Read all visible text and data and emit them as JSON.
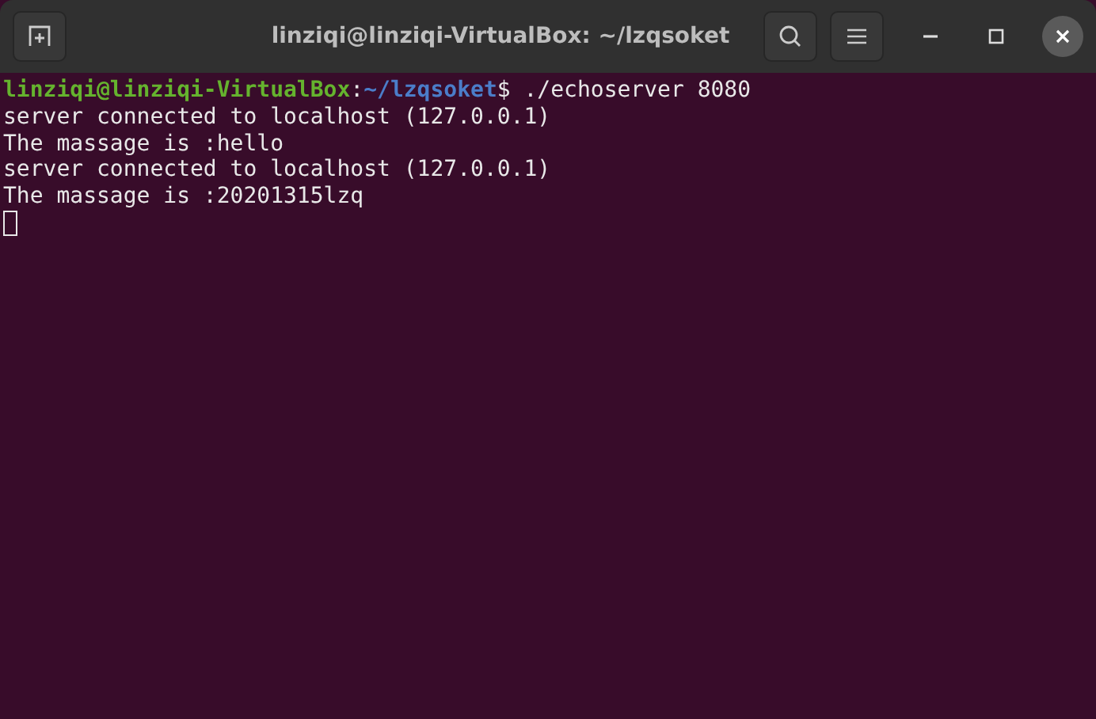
{
  "window": {
    "title": "linziqi@linziqi-VirtualBox: ~/lzqsoket"
  },
  "prompt": {
    "segments": [
      {
        "kind": "user",
        "text": "linziqi@linziqi-VirtualBox"
      },
      {
        "kind": "plain",
        "text": ":"
      },
      {
        "kind": "path",
        "text": "~/lzqsoket"
      },
      {
        "kind": "plain",
        "text": "$ ./echoserver 8080"
      }
    ]
  },
  "output": [
    "server connected to localhost (127.0.0.1)",
    "The massage is :hello",
    "server connected to localhost (127.0.0.1)",
    "The massage is :20201315lzq"
  ]
}
